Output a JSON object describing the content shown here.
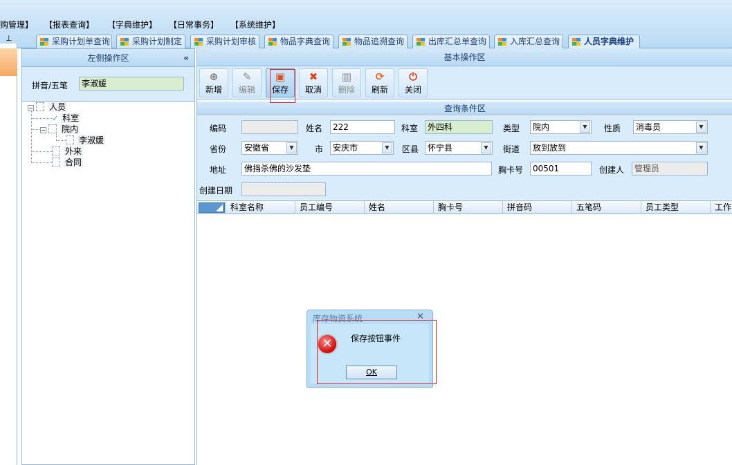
{
  "menu": [
    "购管理】",
    "【报表查询】",
    "【字典维护】",
    "【日常事务】",
    "【系统维护】"
  ],
  "pin_label": "ꟹ",
  "tabs": [
    "采购计划单查询",
    "采购计划制定",
    "采购计划审核",
    "物品字典查询",
    "物品追溯查询",
    "出库汇总单查询",
    "入库汇总查询",
    "人员字典维护"
  ],
  "left": {
    "title": "左侧操作区",
    "collapse": "«",
    "search_label": "拼音/五笔",
    "search_value": "李淑媛",
    "tree": {
      "root": "人员",
      "children": [
        "科室",
        "院内",
        "李淑媛",
        "外来",
        "合同"
      ]
    }
  },
  "main": {
    "title": "基本操作区",
    "toolbar": [
      {
        "label": "新增",
        "icon": "add-icon",
        "glyph": "⊕",
        "color": "#7a7a7a",
        "disabled": false
      },
      {
        "label": "编辑",
        "icon": "edit-icon",
        "glyph": "✎",
        "color": "#8b8b8b",
        "disabled": true
      },
      {
        "label": "保存",
        "icon": "save-icon",
        "glyph": "▣",
        "color": "#d9531e",
        "disabled": false
      },
      {
        "label": "取消",
        "icon": "cancel-icon",
        "glyph": "✖",
        "color": "#e0481c",
        "disabled": false
      },
      {
        "label": "删除",
        "icon": "delete-icon",
        "glyph": "🗑",
        "color": "#8b8b8b",
        "disabled": true
      },
      {
        "label": "刷新",
        "icon": "refresh-icon",
        "glyph": "⟳",
        "color": "#e36c1a",
        "disabled": false
      },
      {
        "label": "关闭",
        "icon": "power-icon",
        "glyph": "⏻",
        "color": "#e0481c",
        "disabled": false
      }
    ],
    "query_title": "查询条件区",
    "fields": {
      "code_label": "编码",
      "code_value": "",
      "name_label": "姓名",
      "name_value": "222",
      "dept_label": "科室",
      "dept_value": "外四科",
      "type_label": "类型",
      "type_value": "院内",
      "nature_label": "性质",
      "nature_value": "消毒员",
      "province_label": "省份",
      "province_value": "安徽省",
      "city_label": "市",
      "city_value": "安庆市",
      "county_label": "区县",
      "county_value": "怀宁县",
      "street_label": "街道",
      "street_value": "放到放到",
      "address_label": "地址",
      "address_value": "佛挡杀佛的沙发垫",
      "card_label": "胸卡号",
      "card_value": "00501",
      "creator_label": "创建人",
      "creator_value": "管理员",
      "date_label": "创建日期",
      "date_value": ""
    },
    "grid_columns": [
      "科室名称",
      "员工编号",
      "姓名",
      "胸卡号",
      "拼音码",
      "五笔码",
      "员工类型",
      "工作"
    ]
  },
  "dialog": {
    "title": "库存物资系统",
    "close": "✕",
    "message": "保存按钮事件",
    "ok": "OK",
    "icon": "error-icon"
  }
}
